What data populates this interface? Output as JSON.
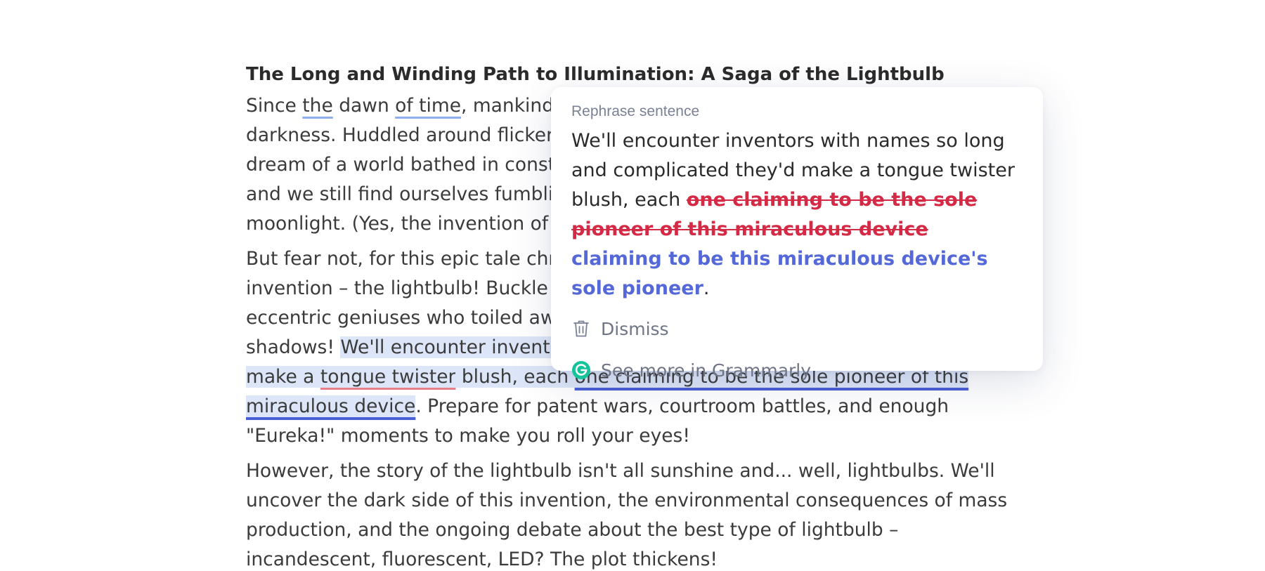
{
  "document": {
    "title": "The Long and Winding Path to Illumination: A Saga of the Lightbulb",
    "p1": {
      "t1": "Since ",
      "w_the": "the",
      "t2": " dawn ",
      "w_oftime": "of time",
      "t3": ", mankind ",
      "t4": "darkness. Huddled around flicker",
      "t5": "dream of a world bathed in const",
      "t6": "and we still find ourselves fumbli",
      "t7": "moonlight.  (Yes, the invention of"
    },
    "p2": {
      "t1": "But fear not, for this epic tale chr",
      "t2": "invention – the lightbulb! Buckle u",
      "t3": "eccentric geniuses who toiled aw",
      "t4": "shadows! ",
      "hl1": "We'll encounter invento",
      "hl2": "make a ",
      "w_tongue": "tongue twister",
      "hl3": " blush, each ",
      "w_claim1": "one claiming to be the sole pioneer of this",
      "w_claim2": "miraculous device",
      "t5": ". Prepare for patent wars, courtroom battles, and enough",
      "t6": "\"Eureka!\" moments to make you roll your eyes!"
    },
    "p3": {
      "t1": "However, the story of the lightbulb isn't all sunshine and... well, lightbulbs. We'll",
      "t2": "uncover the dark side of this invention, the environmental consequences of mass",
      "t3": "production, and the ongoing debate about the best type of lightbulb –",
      "t4": "incandescent, fluorescent, LED? The plot thickens!"
    }
  },
  "suggestion": {
    "label": "Rephrase sentence",
    "text_before": "We'll encounter inventors with names so long and complicated they'd make a tongue twister blush, each ",
    "deleted": "one claiming to be the sole pioneer of this miraculous device",
    "inserted": "claiming to be this miraculous device's sole pioneer",
    "text_after": ".",
    "dismiss_label": "Dismiss",
    "grammarly_label": "See more in Grammarly",
    "colors": {
      "deleted": "#d42a45",
      "inserted": "#5568d8",
      "highlight": "#dde6f8",
      "grammarly_brand": "#15c39a"
    }
  },
  "icons": {
    "dismiss": "trash-icon",
    "grammarly": "grammarly-logo-icon"
  }
}
